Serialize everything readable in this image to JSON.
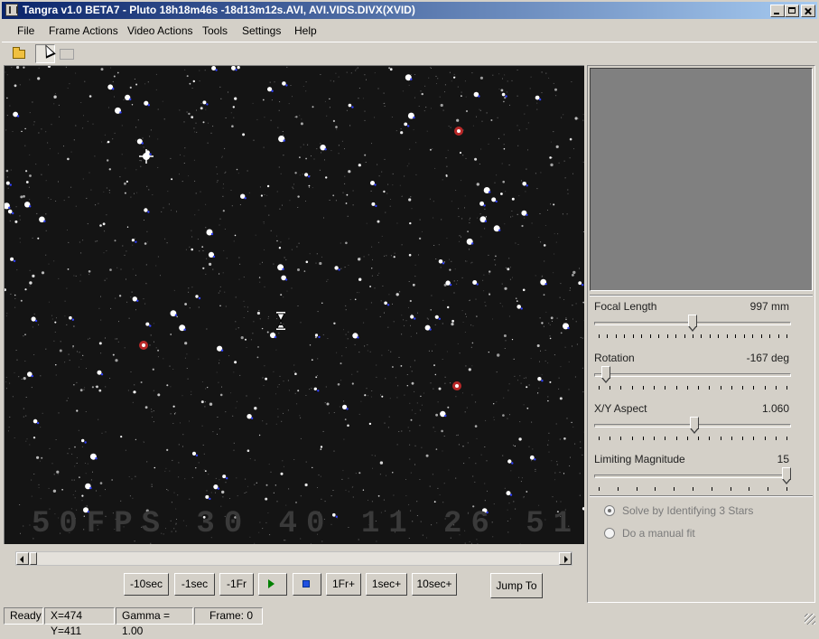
{
  "window": {
    "title": "Tangra v1.0 BETA7 - Pluto 18h18m46s -18d13m12s.AVI, AVI.VIDS.DIVX(XVID)"
  },
  "menu": [
    {
      "label": "File"
    },
    {
      "label": "Frame Actions"
    },
    {
      "label": "Video Actions"
    },
    {
      "label": "Tools"
    },
    {
      "label": "Settings"
    },
    {
      "label": "Help"
    }
  ],
  "toolbar": {
    "open_icon": "folder-open-icon",
    "select_icon": "arrow-pointer-icon",
    "ccd_icon": "ccd-icon"
  },
  "viewer": {
    "overlay_text": "50FPS 30 40 11 26 51",
    "cursor_icon": "hourglass-icon"
  },
  "playback": {
    "buttons": [
      "-10sec",
      "-1sec",
      "-1Fr",
      "",
      "",
      "1Fr+",
      "1sec+",
      "10sec+"
    ],
    "jump_label": "Jump To",
    "progress": 0.01
  },
  "sliders": [
    {
      "label": "Focal Length",
      "value": "997 mm",
      "position": 0.5
    },
    {
      "label": "Rotation",
      "value": "-167 deg",
      "position": 0.04
    },
    {
      "label": "X/Y Aspect",
      "value": "1.060",
      "position": 0.51
    },
    {
      "label": "Limiting Magnitude",
      "value": "15",
      "position": 1.0
    }
  ],
  "options": [
    {
      "label": "Solve by Identifying 3 Stars",
      "selected": true
    },
    {
      "label": "Do a manual fit",
      "selected": false
    }
  ],
  "status": {
    "state": "Ready",
    "coords": "X=474 Y=411",
    "gamma": "Gamma = 1.00",
    "frame": "Frame: 0"
  }
}
